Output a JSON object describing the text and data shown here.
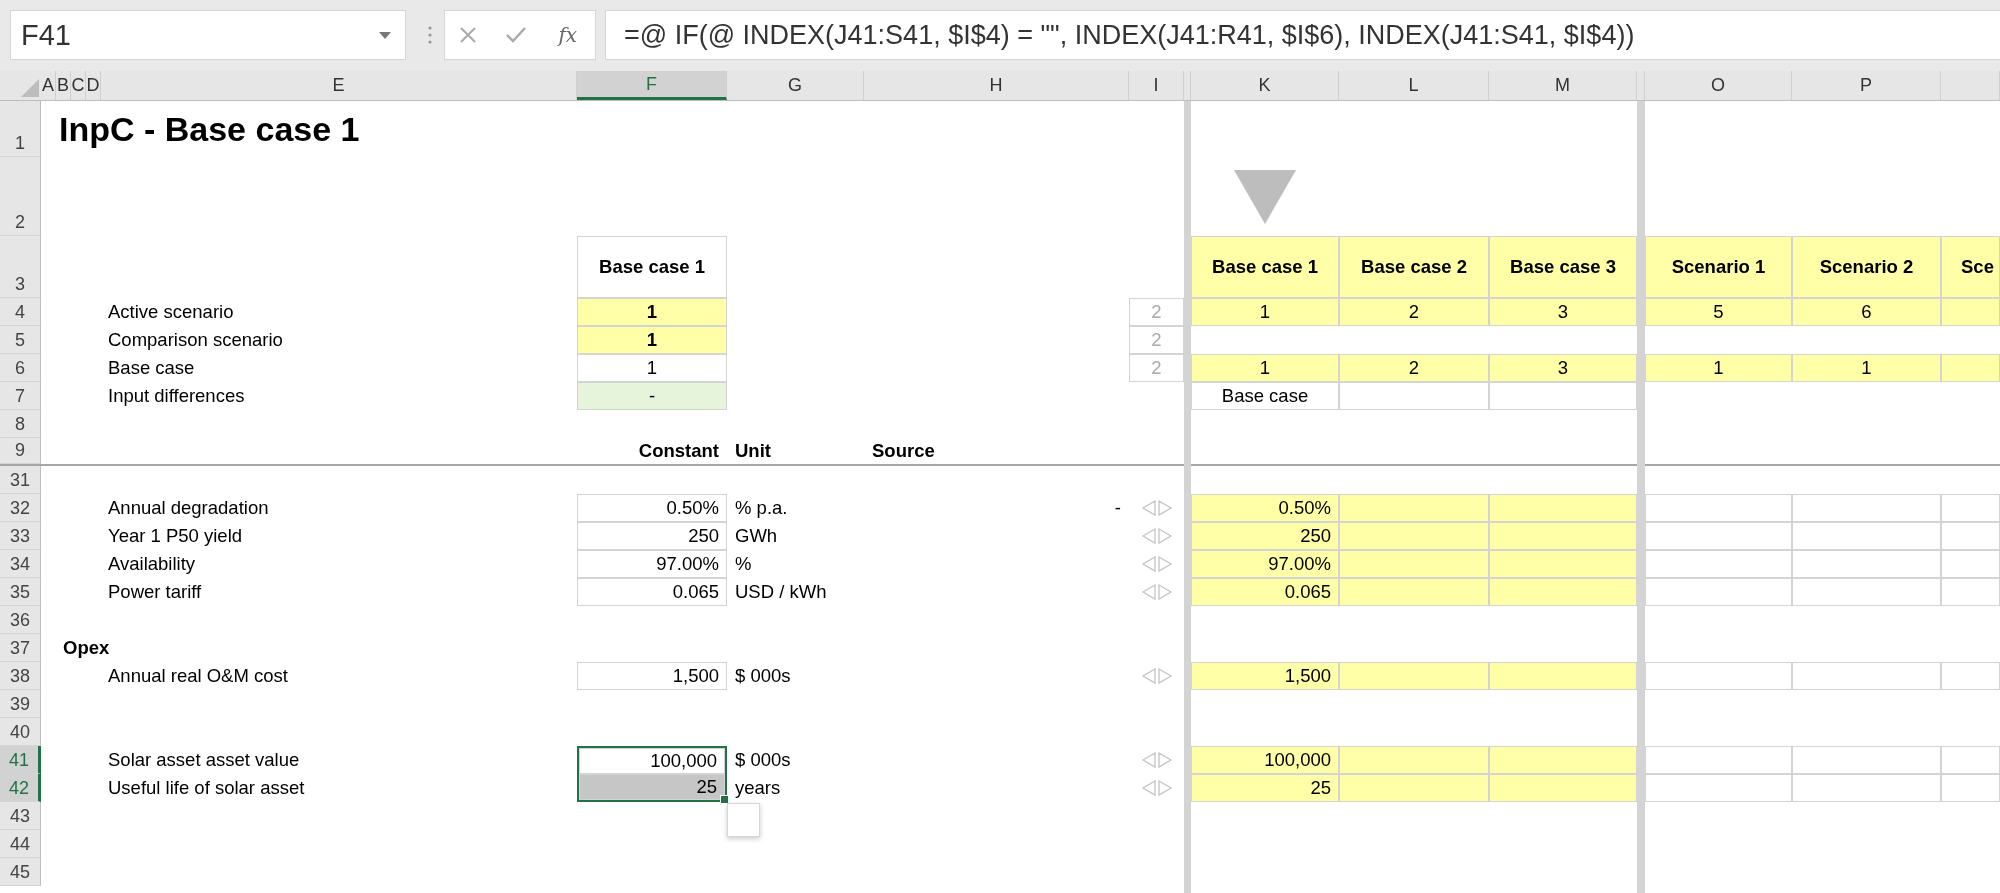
{
  "formula_bar": {
    "name_box": "F41",
    "function_label": "fx",
    "formula": "=@ IF(@ INDEX(J41:S41, $I$4) = \"\", INDEX(J41:R41, $I$6), INDEX(J41:S41, $I$4))"
  },
  "columns": [
    {
      "label": "A",
      "selected": false
    },
    {
      "label": "B",
      "selected": false
    },
    {
      "label": "C",
      "selected": false
    },
    {
      "label": "D",
      "selected": false
    },
    {
      "label": "E",
      "selected": false
    },
    {
      "label": "F",
      "selected": true
    },
    {
      "label": "G",
      "selected": false
    },
    {
      "label": "H",
      "selected": false
    },
    {
      "label": "I",
      "selected": false
    },
    {
      "selected": false
    },
    {
      "label": "K",
      "selected": false
    },
    {
      "label": "L",
      "selected": false
    },
    {
      "label": "M",
      "selected": false
    },
    {
      "selected": false
    },
    {
      "label": "O",
      "selected": false
    },
    {
      "label": "P",
      "selected": false
    },
    {
      "selected": false
    }
  ],
  "rows": [
    {
      "number": "1",
      "selected": false,
      "kind": "title",
      "text": "InpC - Base case 1"
    },
    {
      "number": "2",
      "selected": false,
      "kind": "marker"
    },
    {
      "number": "3",
      "selected": false,
      "kind": "case_header",
      "current": "Base case 1",
      "scenarios": [
        "Base case 1",
        "Base case 2",
        "Base case 3",
        "Scenario 1",
        "Scenario 2",
        "Sce"
      ]
    },
    {
      "number": "4",
      "selected": false,
      "kind": "choice",
      "label": "Active scenario",
      "value": "1",
      "side": "2",
      "values": [
        "1",
        "2",
        "3",
        "5",
        "6"
      ]
    },
    {
      "number": "5",
      "selected": false,
      "kind": "choice",
      "label": "Comparison scenario",
      "value": "1",
      "side": "2"
    },
    {
      "number": "6",
      "selected": false,
      "kind": "basecase",
      "label": "Base case",
      "value": "1",
      "side": "2",
      "values": [
        "1",
        "2",
        "3",
        "1",
        "1"
      ]
    },
    {
      "number": "7",
      "selected": false,
      "kind": "difference",
      "label": "Input differences",
      "value": "-",
      "values": [
        "Base case"
      ]
    },
    {
      "number": "8",
      "selected": false,
      "kind": "blank"
    },
    {
      "number": "9",
      "selected": false,
      "kind": "headers",
      "constant": "Constant",
      "unit": "Unit",
      "source": "Source"
    },
    {
      "number": "31",
      "selected": false,
      "kind": "blank"
    },
    {
      "number": "32",
      "selected": false,
      "kind": "input",
      "label": "Annual degradation",
      "value": "0.50%",
      "unit": "% p.a.",
      "source": "-",
      "values": [
        "0.50%"
      ]
    },
    {
      "number": "33",
      "selected": false,
      "kind": "input",
      "label": "Year 1 P50 yield",
      "value": "250",
      "unit": "GWh",
      "values": [
        "250"
      ]
    },
    {
      "number": "34",
      "selected": false,
      "kind": "input",
      "label": "Availability",
      "value": "97.00%",
      "unit": "%",
      "values": [
        "97.00%"
      ]
    },
    {
      "number": "35",
      "selected": false,
      "kind": "input",
      "label": "Power tariff",
      "value": "0.065",
      "unit": "USD / kWh",
      "values": [
        "0.065"
      ]
    },
    {
      "number": "36",
      "selected": false,
      "kind": "blank"
    },
    {
      "number": "37",
      "selected": false,
      "kind": "section",
      "text": "Opex"
    },
    {
      "number": "38",
      "selected": false,
      "kind": "input",
      "label": "Annual real O&M cost",
      "value": "1,500",
      "unit": "$ 000s",
      "values": [
        "1,500"
      ]
    },
    {
      "number": "39",
      "selected": false,
      "kind": "blank"
    },
    {
      "number": "40",
      "selected": false,
      "kind": "blank"
    },
    {
      "number": "41",
      "selected": true,
      "kind": "input",
      "label": "Solar asset asset value",
      "value": "100,000",
      "unit": "$ 000s",
      "value_selected": true,
      "active": true,
      "values": [
        "100,000"
      ]
    },
    {
      "number": "42",
      "selected": true,
      "kind": "input",
      "label": "Useful life of solar asset",
      "value": "25",
      "unit": "years",
      "value_selected": true,
      "active": false,
      "values": [
        "25"
      ]
    },
    {
      "number": "43",
      "selected": false,
      "kind": "blank"
    },
    {
      "number": "44",
      "selected": false,
      "kind": "blank"
    },
    {
      "number": "45",
      "selected": false,
      "kind": "blank"
    }
  ]
}
